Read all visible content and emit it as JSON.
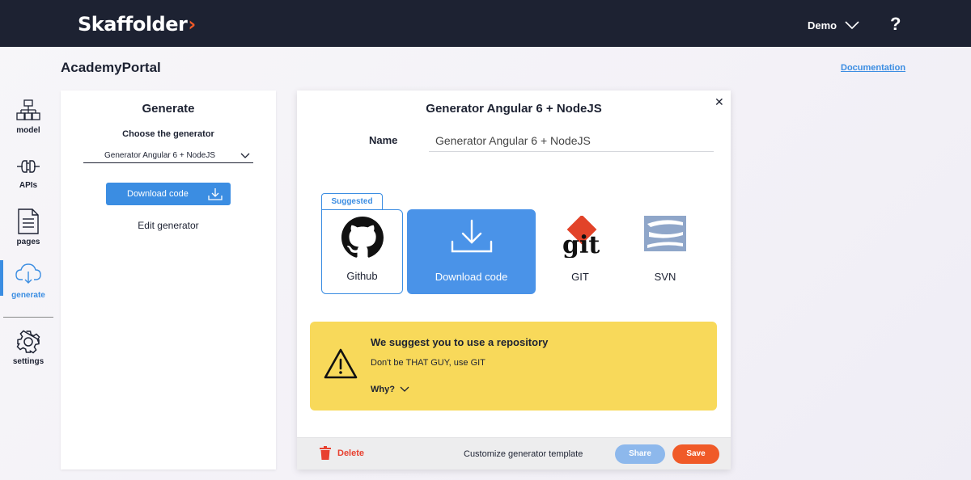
{
  "header": {
    "logo_text": "Skaffolder",
    "logo_chevron": "›",
    "account_label": "Demo",
    "help_label": "?"
  },
  "project": {
    "title": "AcademyPortal",
    "documentation_label": "Documentation"
  },
  "nav": {
    "items": [
      {
        "label": "model",
        "icon": "model-icon"
      },
      {
        "label": "APIs",
        "icon": "api-icon"
      },
      {
        "label": "pages",
        "icon": "pages-icon"
      },
      {
        "label": "generate",
        "icon": "generate-icon",
        "active": true
      },
      {
        "label": "settings",
        "icon": "settings-icon"
      }
    ]
  },
  "generate_panel": {
    "title": "Generate",
    "choose_label": "Choose the generator",
    "selected_generator": "Generator Angular 6 + NodeJS",
    "download_label": "Download code",
    "edit_label": "Edit generator"
  },
  "modal": {
    "title": "Generator Angular 6 + NodeJS",
    "name_label": "Name",
    "name_value": "Generator Angular 6 + NodeJS",
    "suggested_label": "Suggested",
    "options": [
      {
        "label": "Github",
        "icon": "github-icon"
      },
      {
        "label": "Download code",
        "icon": "download-icon"
      },
      {
        "label": "GIT",
        "icon": "git-logo"
      },
      {
        "label": "SVN",
        "icon": "svn-logo"
      }
    ],
    "warning": {
      "title": "We suggest you to use a repository",
      "text": "Don't be THAT GUY, use GIT",
      "why_label": "Why?"
    },
    "footer": {
      "delete_label": "Delete",
      "customize_label": "Customize generator template",
      "share_label": "Share",
      "save_label": "Save"
    }
  },
  "colors": {
    "topbar": "#1d2232",
    "accent": "#3b8de2",
    "orange": "#f05a28",
    "warning": "#f8d95a",
    "danger": "#e8402f"
  }
}
